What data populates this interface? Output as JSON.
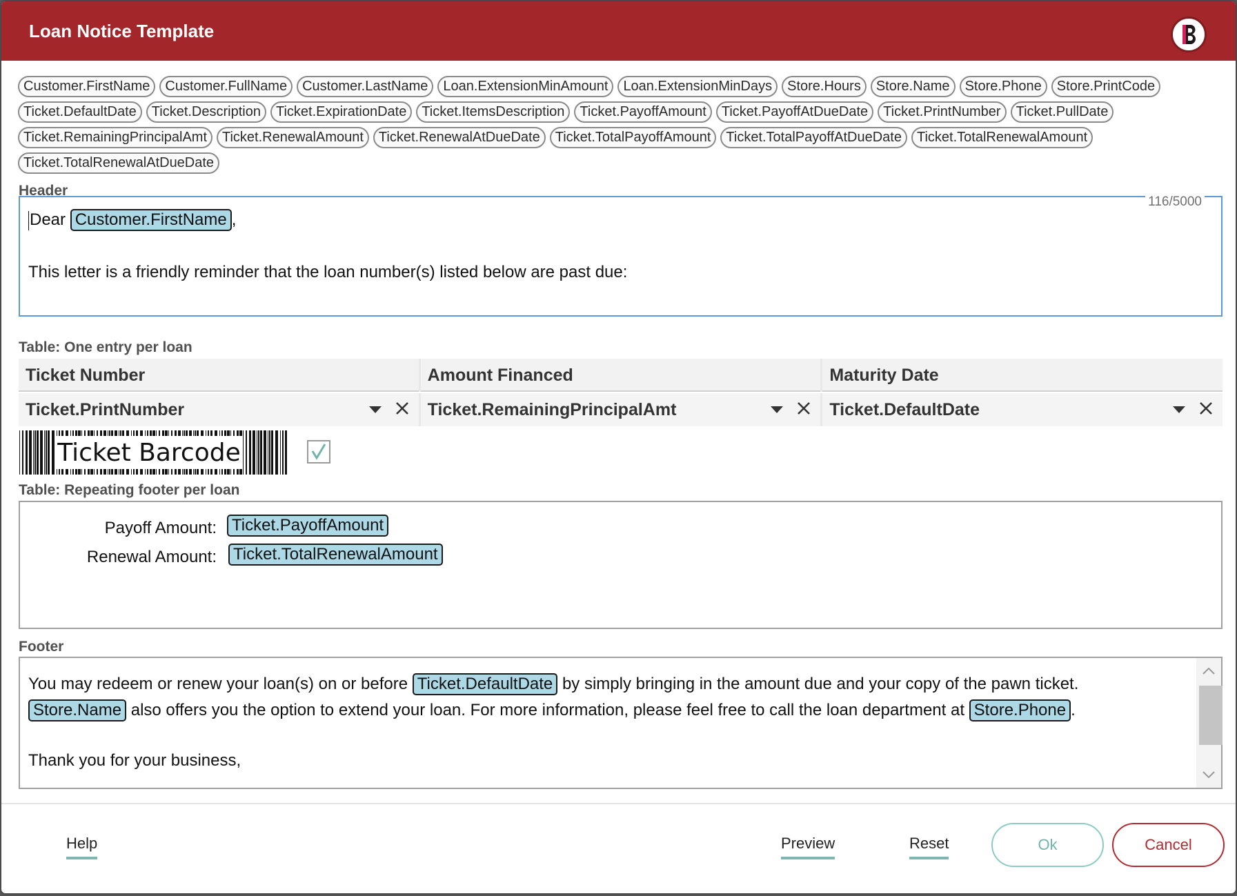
{
  "window": {
    "title": "Loan Notice Template",
    "accent_color": "#a3262a",
    "logo_icon": "brand-b-logo-icon",
    "logo_letter": "B"
  },
  "tokens": [
    "Customer.FirstName",
    "Customer.FullName",
    "Customer.LastName",
    "Loan.ExtensionMinAmount",
    "Loan.ExtensionMinDays",
    "Store.Hours",
    "Store.Name",
    "Store.Phone",
    "Store.PrintCode",
    "Ticket.DefaultDate",
    "Ticket.Description",
    "Ticket.ExpirationDate",
    "Ticket.ItemsDescription",
    "Ticket.PayoffAmount",
    "Ticket.PayoffAtDueDate",
    "Ticket.PrintNumber",
    "Ticket.PullDate",
    "Ticket.RemainingPrincipalAmt",
    "Ticket.RenewalAmount",
    "Ticket.RenewalAtDueDate",
    "Ticket.TotalPayoffAmount",
    "Ticket.TotalPayoffAtDueDate",
    "Ticket.TotalRenewalAmount",
    "Ticket.TotalRenewalAtDueDate"
  ],
  "header": {
    "label": "Header",
    "counter": "116/5000",
    "greeting": "Dear",
    "greeting_token": "Customer.FirstName",
    "greeting_suffix": ",",
    "body": "This letter is a friendly reminder that the loan number(s) listed below are past due:"
  },
  "table": {
    "label": "Table: One entry per loan",
    "columns": [
      "Ticket Number",
      "Amount Financed",
      "Maturity Date"
    ],
    "fields": [
      "Ticket.PrintNumber",
      "Ticket.RemainingPrincipalAmt",
      "Ticket.DefaultDate"
    ],
    "barcode_text": "Ticket Barcode",
    "barcode_checked": true
  },
  "repeating_footer": {
    "label": "Table: Repeating footer per loan",
    "payoff_label": "Payoff Amount:",
    "payoff_token": "Ticket.PayoffAmount",
    "renewal_label": "Renewal Amount:",
    "renewal_token": "Ticket.TotalRenewalAmount"
  },
  "footer": {
    "label": "Footer",
    "line1_a": "You may redeem or renew your loan(s) on or before",
    "line1_token": "Ticket.DefaultDate",
    "line1_b": "by simply bringing in the amount due and your copy of the pawn ticket.",
    "line2_token": "Store.Name",
    "line2_a": "also offers you the option to extend your loan. For more information, please feel free to call the loan department at",
    "line2_token2": "Store.Phone",
    "line2_b": ".",
    "line3": "Thank you for your business,"
  },
  "buttons": {
    "help": "Help",
    "preview": "Preview",
    "reset": "Reset",
    "ok": "Ok",
    "cancel": "Cancel"
  }
}
